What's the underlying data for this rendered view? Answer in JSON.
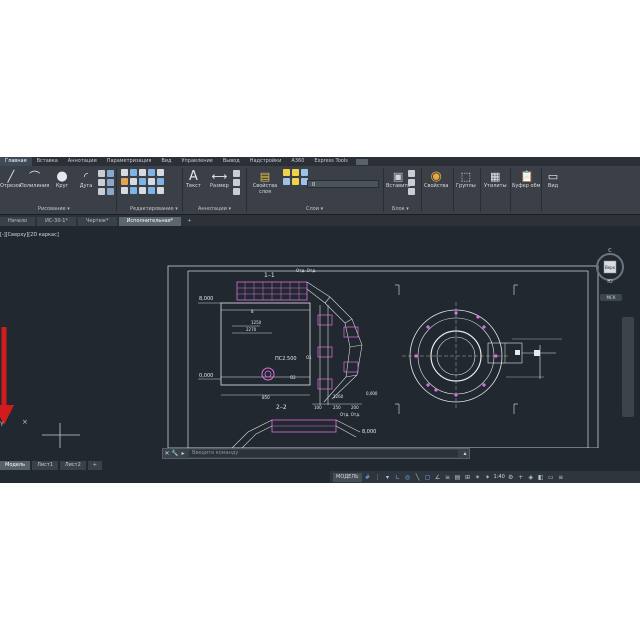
{
  "ribbon_tabs": [
    "Главная",
    "Вставка",
    "Аннотации",
    "Параметризация",
    "Вид",
    "Управление",
    "Вывод",
    "Надстройки",
    "A360",
    "Express Tools"
  ],
  "ribbon": {
    "tools": {
      "segment": "Отрезок",
      "polyline": "Полилиния",
      "circle": "Круг",
      "arc": "Дуга",
      "text": "Текст",
      "dimension": "Размер",
      "layer_properties": "Свойства слоя",
      "insert": "Вставить",
      "properties": "Свойства",
      "groups": "Группы",
      "utilities": "Утилиты",
      "clipboard": "Буфер обм.",
      "view": "Вид"
    },
    "layer_combo": "0",
    "panels": {
      "draw": "Рисование ▾",
      "modify": "Редактирование ▾",
      "annotation": "Аннотации ▾",
      "layers": "Слои ▾",
      "block": "Блок ▾"
    }
  },
  "doc_tabs": [
    "Начало",
    "ИС-30-1*",
    "Чертеж*",
    "Исполнительная*",
    "+"
  ],
  "view_label": "[-][Сверху][2D каркас]",
  "drawing": {
    "section_1_label": "1–1",
    "section_2_label": "2–2",
    "mark_a": "Отд. Отд.",
    "mark_b": "Отд. Отд.",
    "elev_top": "8,000",
    "elev_mid": "0,000",
    "elev_right": "0,000",
    "elev_low": "8,000",
    "pipe_label": "ПС2.500",
    "dim_1250": "1250",
    "dim_2270": "2270",
    "dim_850": "850",
    "dim_01": "О1",
    "dim_02": "О2",
    "dim_1260": "1260",
    "dim_100": "100",
    "dim_250": "250",
    "dim_200": "200",
    "dim_s": "8"
  },
  "viewcube": {
    "north": "С",
    "south": "Ю",
    "face": "Верх",
    "wcs": "МСК"
  },
  "command_placeholder": "Введите команду",
  "layout_tabs": [
    "Модель",
    "Лист1",
    "Лист2",
    "+"
  ],
  "status": {
    "model": "МОДЕЛЬ",
    "scale": "1:40"
  }
}
